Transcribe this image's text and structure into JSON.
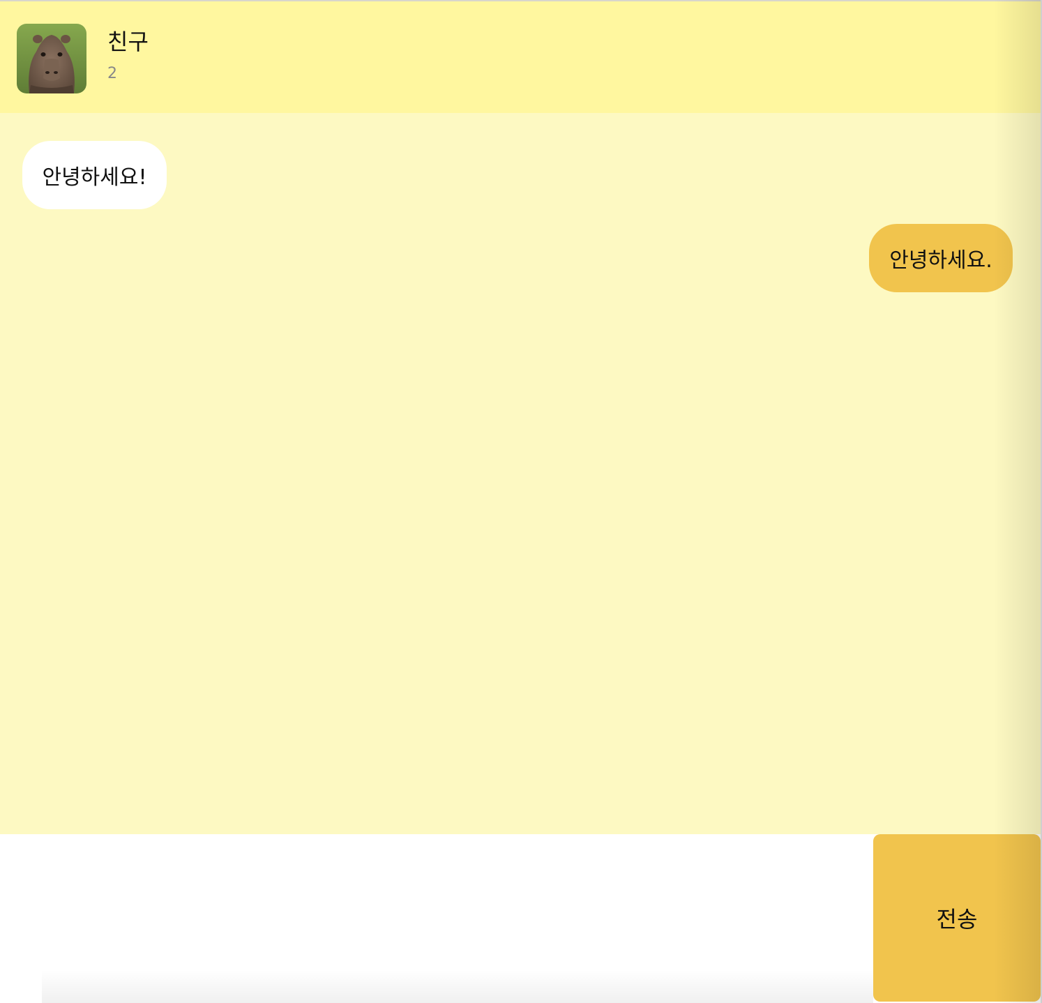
{
  "header": {
    "name": "친구",
    "count": "2",
    "avatar": "capybara-photo"
  },
  "messages": [
    {
      "side": "received",
      "text": "안녕하세요!"
    },
    {
      "side": "sent",
      "text": "안녕하세요."
    }
  ],
  "composer": {
    "input_value": "",
    "send_label": "전송"
  },
  "colors": {
    "header_bg": "#fff79f",
    "chat_bg": "#fdf9c2",
    "sent_bubble": "#f1c44d",
    "received_bubble": "#ffffff",
    "send_button": "#f1c44d"
  }
}
